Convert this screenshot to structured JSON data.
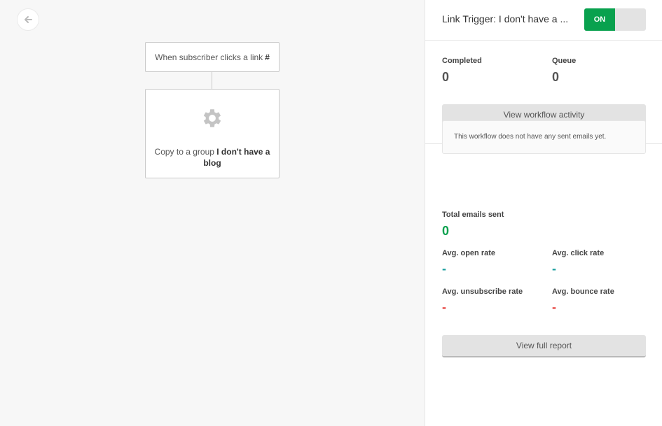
{
  "canvas": {
    "trigger_text": "When subscriber clicks a link",
    "trigger_link": "#",
    "action_prefix": "Copy to a group",
    "action_group": "I don't have a blog"
  },
  "panel": {
    "title": "Link Trigger: I don't have a ...",
    "toggle_label": "ON",
    "completed_label": "Completed",
    "completed_value": "0",
    "queue_label": "Queue",
    "queue_value": "0",
    "activity_button": "View workflow activity",
    "no_emails_text": "This workflow does not have any sent emails yet.",
    "total_sent_label": "Total emails sent",
    "total_sent_value": "0",
    "open_rate_label": "Avg. open rate",
    "open_rate_value": "-",
    "click_rate_label": "Avg. click rate",
    "click_rate_value": "-",
    "unsub_rate_label": "Avg. unsubscribe rate",
    "unsub_rate_value": "-",
    "bounce_rate_label": "Avg. bounce rate",
    "bounce_rate_value": "-",
    "report_button": "View full report"
  },
  "colors": {
    "accent": "#09a14e",
    "neutral_rate": "#1a9e9e",
    "negative_rate": "#e53935"
  }
}
